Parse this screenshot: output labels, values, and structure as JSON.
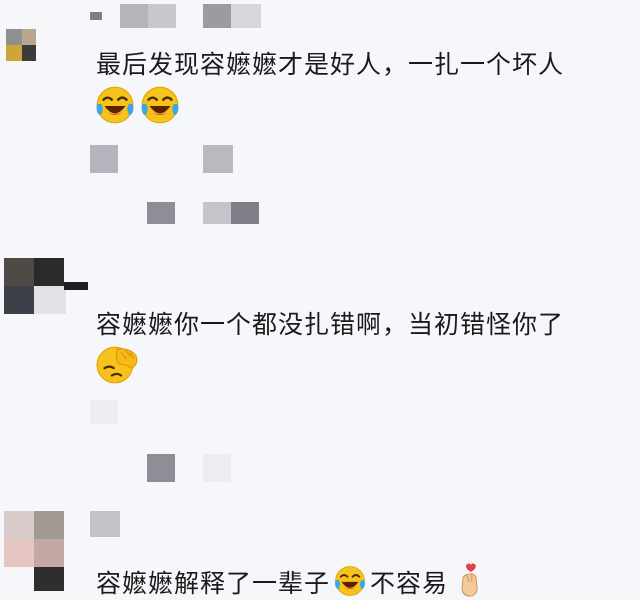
{
  "comments": [
    {
      "text": "最后发现容嬷嬷才是好人，一扎一个坏人",
      "emojis": [
        "laugh-cry-emoji",
        "laugh-cry-emoji"
      ]
    },
    {
      "text": "容嬷嬷你一个都没扎错啊，当初错怪你了",
      "emojis": [
        "facepalm-emoji"
      ]
    },
    {
      "text_before": "容嬷嬷解释了一辈子",
      "text_after": "不容易",
      "emojis": [
        "laugh-cry-emoji",
        "finger-heart-emoji"
      ]
    }
  ],
  "colors": {
    "background": "#f6f7fb",
    "text": "#1a1a1a",
    "mosaic_dark": "#8d8e96",
    "mosaic_mid": "#b4b5bc",
    "mosaic_light": "#d6d7dd",
    "emoji_yellow": "#f7c21c",
    "tear_blue": "#3da7e6"
  }
}
